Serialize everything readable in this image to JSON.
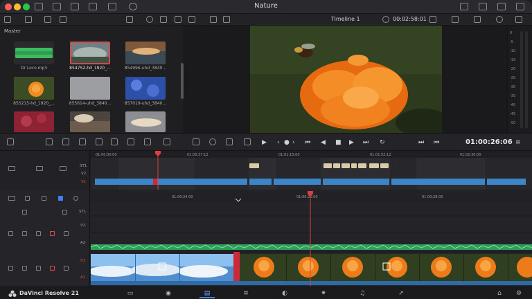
{
  "window": {
    "title": "Nature"
  },
  "toolbar": {
    "timeline_name": "Timeline 1",
    "source_timecode": "00:02:58:01"
  },
  "media_pool": {
    "header": "Master",
    "clips": [
      {
        "name": "Dr Loco.mp3",
        "type": "audio"
      },
      {
        "name": "854752-hd_1920_...",
        "type": "video"
      },
      {
        "name": "854996-uhd_3840...",
        "type": "video"
      },
      {
        "name": "855215-hd_1920_...",
        "type": "video"
      },
      {
        "name": "855614-uhd_3840...",
        "type": "video"
      },
      {
        "name": "857019-uhd_3840...",
        "type": "video"
      },
      {
        "name": "",
        "type": "video"
      },
      {
        "name": "",
        "type": "video"
      },
      {
        "name": "",
        "type": "video"
      }
    ]
  },
  "meters": {
    "labels": [
      "0",
      "-5",
      "-10",
      "-15",
      "-20",
      "-25",
      "-30",
      "-35",
      "-40",
      "-45",
      "-50"
    ]
  },
  "transport": {
    "timecode": "01:00:26:06"
  },
  "upper_timeline": {
    "ruler": [
      "01:00:00:00",
      "01:00:37:12",
      "01:01:15:00",
      "01:01:52:12",
      "01:02:30:00"
    ],
    "tracks": [
      "ST1",
      "V2",
      "V1"
    ]
  },
  "lower_timeline": {
    "ruler": [
      "01:00:24:00",
      "01:00:26:00",
      "01:00:28:00"
    ],
    "tracks": [
      "ST1",
      "V2",
      "A2",
      "V1",
      "A1"
    ]
  },
  "footer": {
    "brand": "DaVinci Resolve 21"
  },
  "colors": {
    "accent": "#3f7fff",
    "playhead": "#e23b3b",
    "audio_clip": "#2e9e5b",
    "video_clip_bar": "#3a86c8"
  }
}
